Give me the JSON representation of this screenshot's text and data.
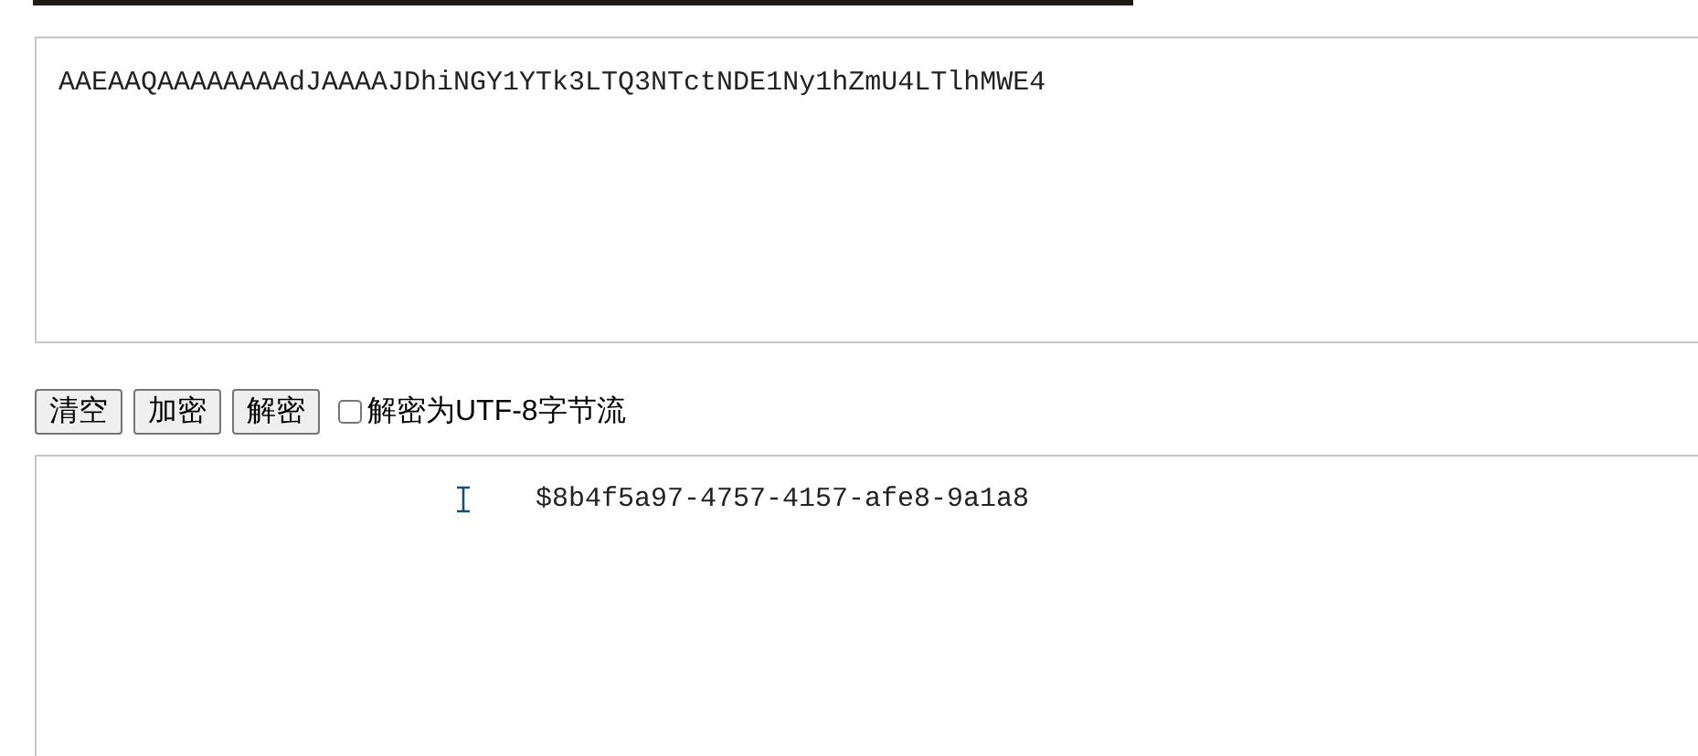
{
  "input": {
    "value": "AAEAAQAAAAAAAAdJAAAAJDhiNGY1YTk3LTQ3NTctNDE1Ny1hZmU4LTlhMWE4"
  },
  "buttons": [
    "清空",
    "加密",
    "解密"
  ],
  "utf8_option": {
    "label": "解密为UTF-8字节流",
    "checked": false
  },
  "output": {
    "value": "$8b4f5a97-4757-4157-afe8-9a1a8"
  }
}
